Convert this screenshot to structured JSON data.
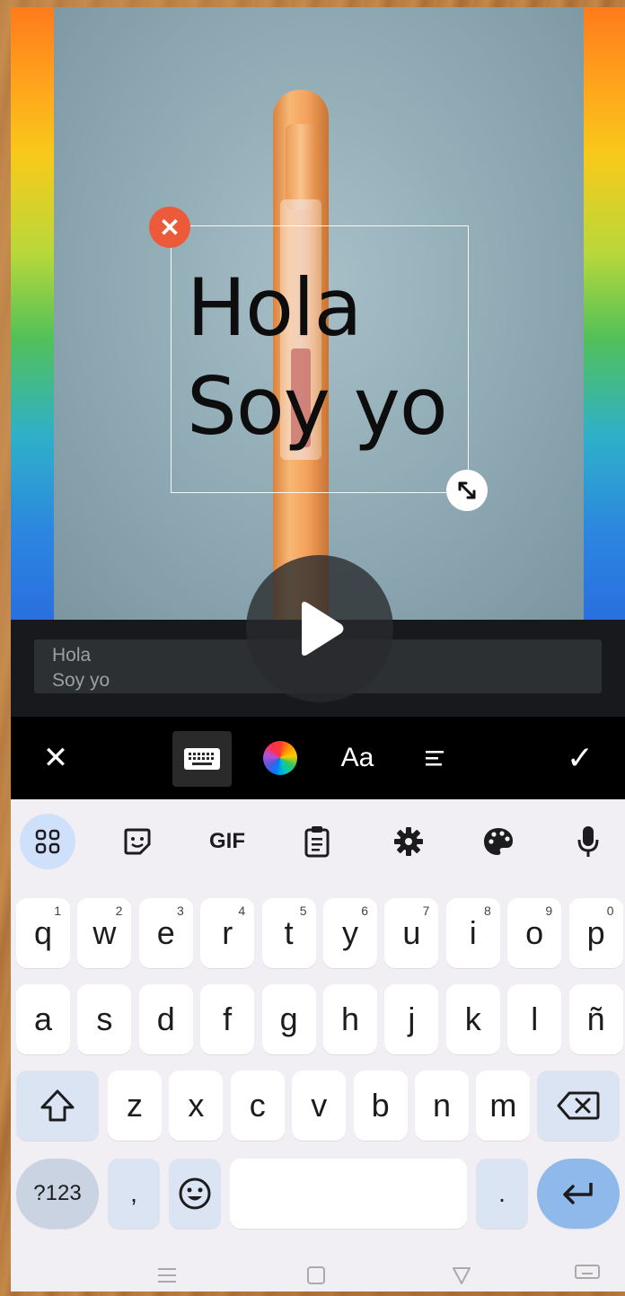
{
  "sticker": {
    "line1": "Hola",
    "line2": "Soy yo",
    "delete_glyph": "✕"
  },
  "text_input": {
    "value": "Hola\nSoy yo"
  },
  "toolbar": {
    "close_glyph": "✕",
    "font_label": "Aa",
    "confirm_glyph": "✓"
  },
  "suggestions": {
    "gif_label": "GIF"
  },
  "keyboard": {
    "row1": [
      {
        "k": "q",
        "h": "1"
      },
      {
        "k": "w",
        "h": "2"
      },
      {
        "k": "e",
        "h": "3"
      },
      {
        "k": "r",
        "h": "4"
      },
      {
        "k": "t",
        "h": "5"
      },
      {
        "k": "y",
        "h": "6"
      },
      {
        "k": "u",
        "h": "7"
      },
      {
        "k": "i",
        "h": "8"
      },
      {
        "k": "o",
        "h": "9"
      },
      {
        "k": "p",
        "h": "0"
      }
    ],
    "row2": [
      "a",
      "s",
      "d",
      "f",
      "g",
      "h",
      "j",
      "k",
      "l",
      "ñ"
    ],
    "row3": [
      "z",
      "x",
      "c",
      "v",
      "b",
      "n",
      "m"
    ],
    "symbols_label": "?123",
    "comma": ",",
    "period": "."
  },
  "colors": {
    "delete": "#ec5a3a",
    "enter": "#8fb9ea",
    "toolbar_bg": "#000000"
  },
  "icons": [
    "close-icon",
    "keyboard-icon",
    "color-wheel-icon",
    "font-icon",
    "align-icon",
    "check-icon",
    "apps-grid-icon",
    "sticker-icon",
    "clipboard-icon",
    "settings-icon",
    "palette-icon",
    "mic-icon",
    "shift-icon",
    "backspace-icon",
    "emoji-icon",
    "enter-icon",
    "play-icon",
    "resize-icon"
  ]
}
